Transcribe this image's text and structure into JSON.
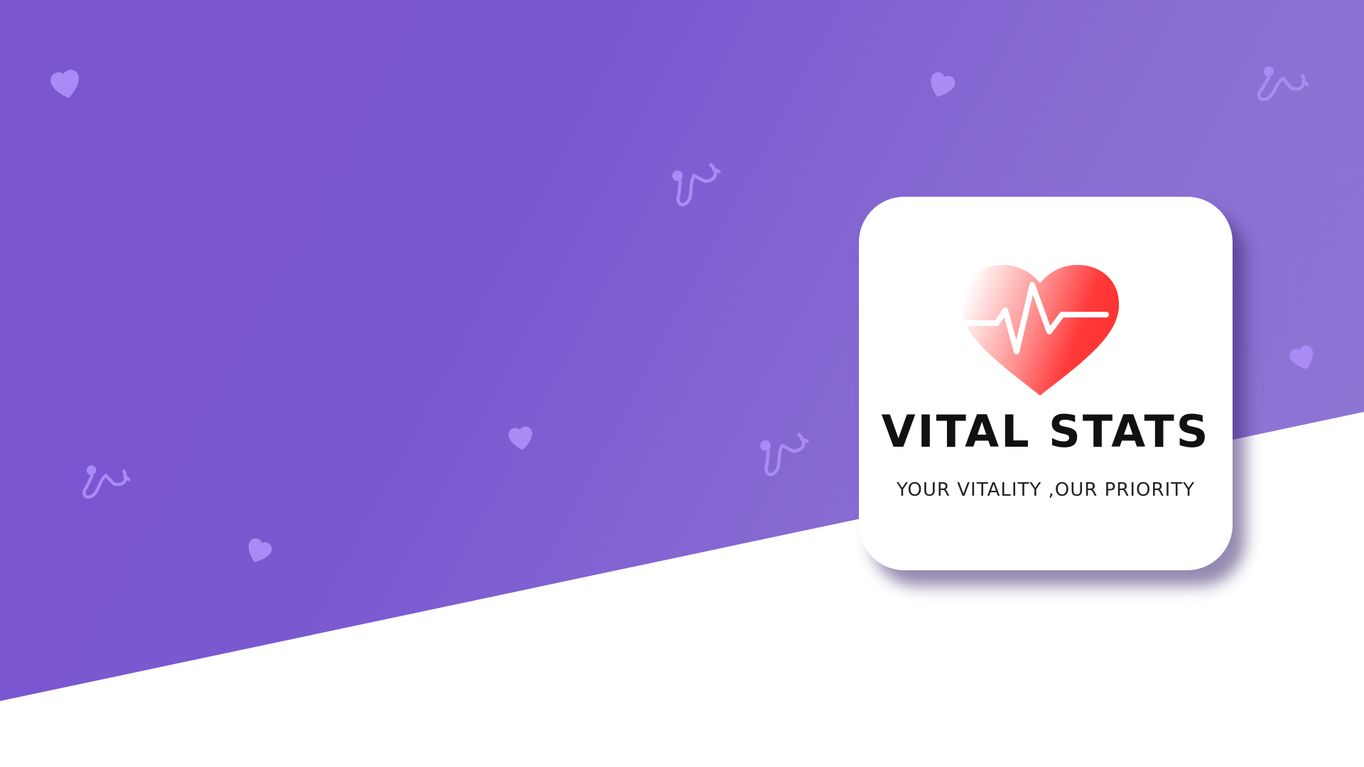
{
  "brand": {
    "app_name": "VITAL STATS",
    "tagline": "YOUR VITALITY ,OUR PRIORITY"
  },
  "colors": {
    "background_purple": "#7a56cf",
    "background_white": "#ffffff",
    "heart_red": "#ff3434",
    "icon_lilac": "#a98bf5",
    "text_dark": "#111111"
  },
  "icons": {
    "logo": "heart-pulse-icon",
    "background_pattern": [
      "heart-icon",
      "stethoscope-icon"
    ]
  }
}
